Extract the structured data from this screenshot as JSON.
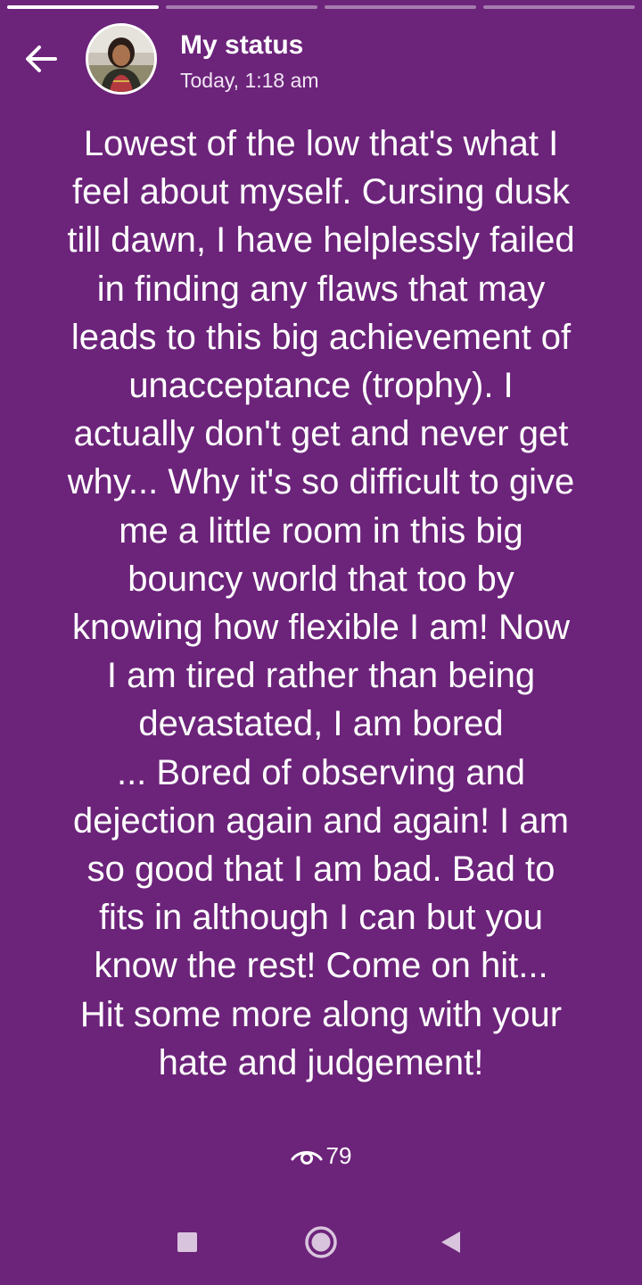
{
  "status": {
    "title": "My status",
    "timestamp": "Today, 1:18 am",
    "text": "Lowest of the low that's what I\nfeel about myself. Cursing dusk\ntill dawn, I have helplessly failed\nin finding any flaws that may\nleads to this big achievement of\nunacceptance (trophy). I\nactually don't get and never get\nwhy... Why it's so difficult to give\nme a little room in this big\nbouncy world that too by\nknowing how flexible I am! Now\nI am tired rather than being\ndevastated, I am bored\n... Bored of observing and\ndejection again and again! I am\nso good that I am bad. Bad to\nfits in although I can but you\nknow the rest!  Come on hit...\nHit some more along with your\nhate and judgement!",
    "views": "79",
    "progress": [
      1,
      0,
      0,
      0
    ]
  },
  "icons": {
    "back": "arrow-left-icon",
    "views": "eye-icon",
    "nav": [
      "square-recents-icon",
      "circle-home-icon",
      "triangle-back-icon"
    ]
  },
  "colors": {
    "background": "#6c237a",
    "foreground": "#ffffff"
  }
}
